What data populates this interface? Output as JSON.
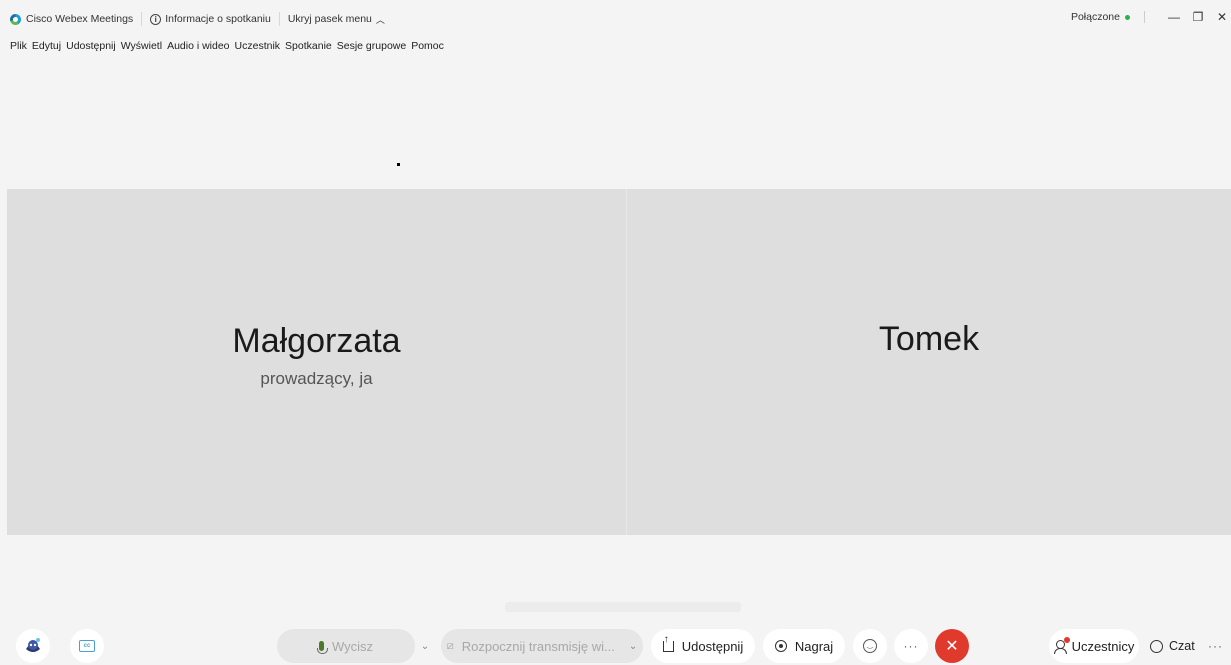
{
  "titlebar": {
    "app_name": "Cisco Webex Meetings",
    "meeting_info": "Informacje o spotkaniu",
    "hide_menu": "Ukryj pasek menu",
    "status": "Połączone",
    "minimize": "—",
    "restore": "❐",
    "close": "✕"
  },
  "menu": {
    "items": [
      "Plik",
      "Edytuj",
      "Udostępnij",
      "Wyświetl",
      "Audio i wideo",
      "Uczestnik",
      "Spotkanie",
      "Sesje grupowe",
      "Pomoc"
    ]
  },
  "tiles": [
    {
      "name": "Małgorzata",
      "role": "prowadzący, ja"
    },
    {
      "name": "Tomek",
      "role": ""
    }
  ],
  "controls": {
    "mute": "Wycisz",
    "start_video": "Rozpocznij transmisję wi...",
    "share": "Udostępnij",
    "record": "Nagraj",
    "end": "✕",
    "more": "···",
    "participants": "Uczestnicy",
    "chat": "Czat",
    "overflow": "···"
  },
  "colors": {
    "end_button": "#e03a2c",
    "connected": "#2fae4d",
    "tile_background": "#dedede"
  }
}
